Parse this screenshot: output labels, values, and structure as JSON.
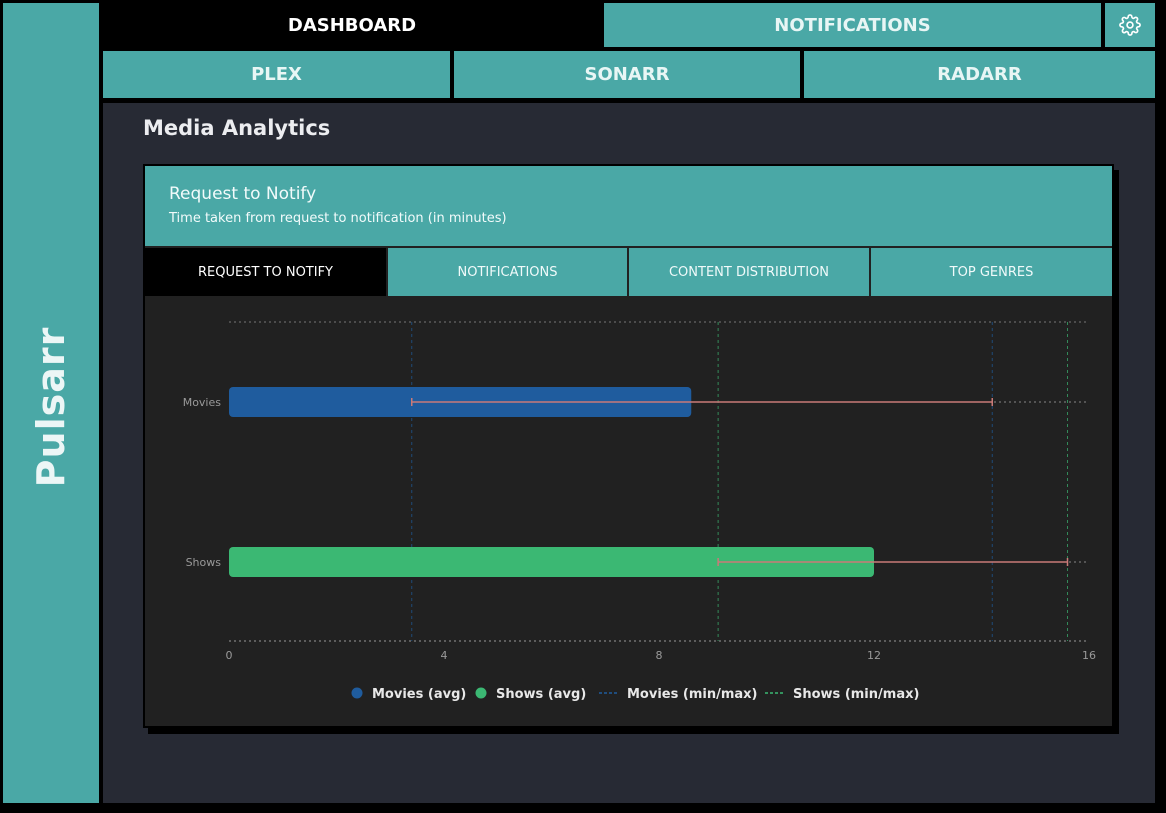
{
  "app": {
    "brand": "Pulsarr"
  },
  "top_nav": {
    "tabs": [
      {
        "label": "DASHBOARD",
        "active": true
      },
      {
        "label": "NOTIFICATIONS",
        "active": false
      }
    ],
    "settings_icon": "gear-icon"
  },
  "sub_nav": {
    "tabs": [
      {
        "label": "PLEX"
      },
      {
        "label": "SONARR"
      },
      {
        "label": "RADARR"
      }
    ]
  },
  "page": {
    "title": "Media Analytics"
  },
  "card": {
    "title": "Request to Notify",
    "subtitle": "Time taken from request to notification (in minutes)",
    "tabs": [
      {
        "label": "REQUEST TO NOTIFY",
        "active": true
      },
      {
        "label": "NOTIFICATIONS",
        "active": false
      },
      {
        "label": "CONTENT DISTRIBUTION",
        "active": false
      },
      {
        "label": "TOP GENRES",
        "active": false
      }
    ]
  },
  "colors": {
    "accent": "#4aa8a6",
    "movies": "#1f5c9e",
    "shows": "#3bb873",
    "range": "#c97a78"
  },
  "chart_data": {
    "type": "bar",
    "orientation": "horizontal",
    "categories": [
      "Movies",
      "Shows"
    ],
    "series": [
      {
        "name": "Movies (avg)",
        "values": [
          8.6,
          null
        ]
      },
      {
        "name": "Shows (avg)",
        "values": [
          null,
          12.0
        ]
      }
    ],
    "ranges": [
      {
        "category": "Movies",
        "min": 3.4,
        "max": 14.2
      },
      {
        "category": "Shows",
        "min": 9.1,
        "max": 15.6
      }
    ],
    "xticks": [
      0,
      4,
      8,
      12,
      16
    ],
    "xlim": [
      0,
      16
    ],
    "grid": true,
    "legend": {
      "position": "bottom",
      "items": [
        "Movies (avg)",
        "Shows (avg)",
        "Movies (min/max)",
        "Shows (min/max)"
      ]
    }
  }
}
